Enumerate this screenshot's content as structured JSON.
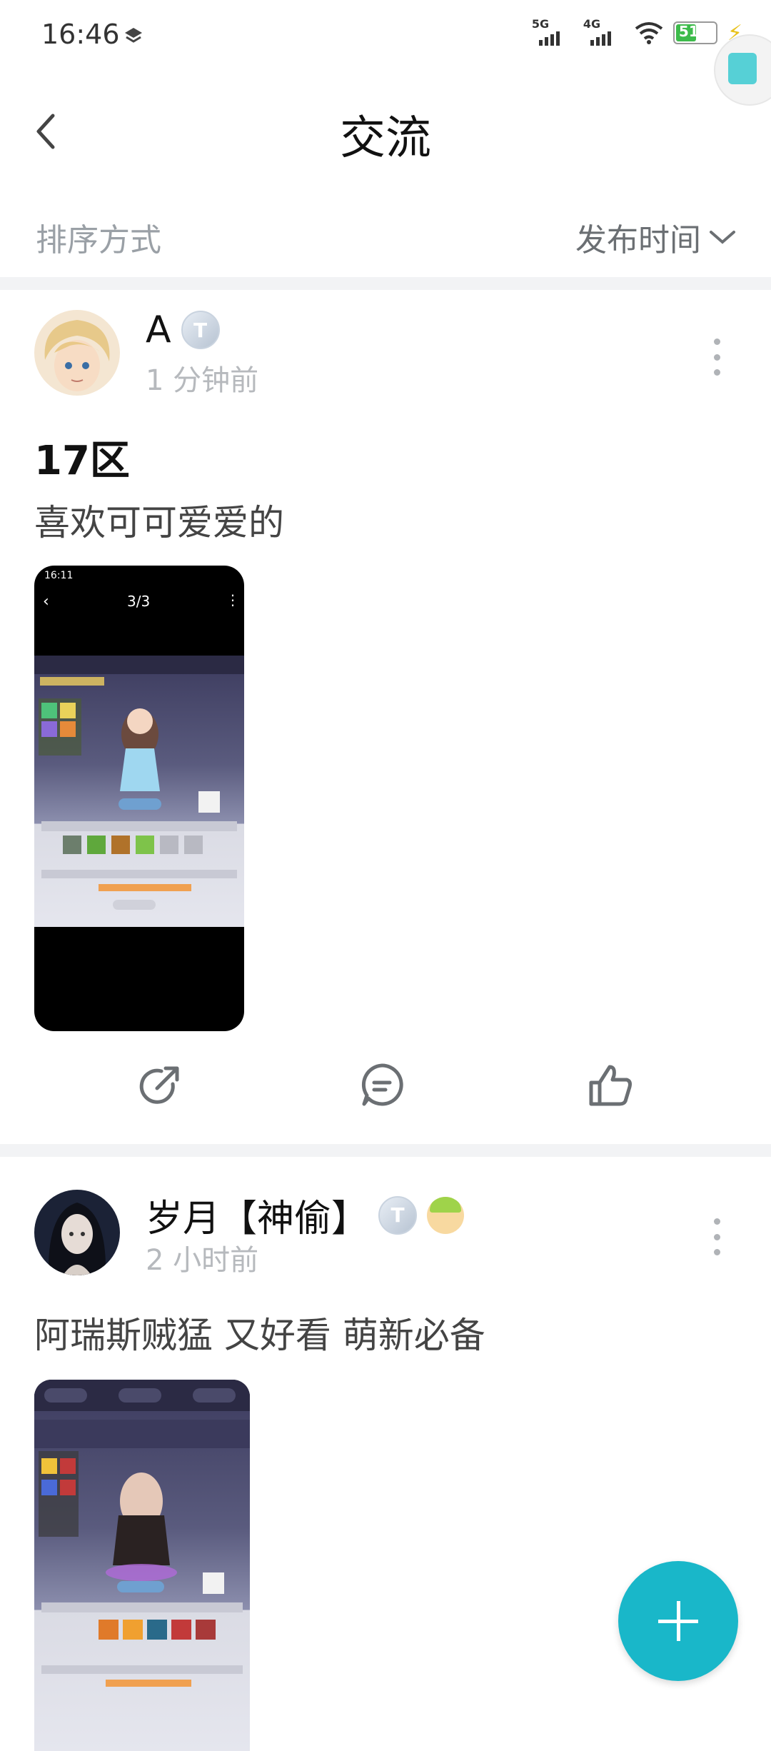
{
  "status_bar": {
    "time": "16:46",
    "net1": "5G",
    "net2": "4G",
    "battery": "51"
  },
  "header": {
    "title": "交流"
  },
  "sort": {
    "label": "排序方式",
    "value": "发布时间"
  },
  "posts": [
    {
      "username": "A",
      "level_badge": "T",
      "time": "1 分钟前",
      "title": "17区",
      "text": "喜欢可可爱爱的",
      "thumb": {
        "time": "16:11",
        "page": "3/3"
      }
    },
    {
      "username": "岁月【神偷】",
      "level_badge": "T",
      "time": "2 小时前",
      "title": "",
      "text": "阿瑞斯贼猛 又好看 萌新必备"
    }
  ],
  "colors": {
    "accent": "#19b7c9",
    "divider": "#f2f3f5"
  }
}
